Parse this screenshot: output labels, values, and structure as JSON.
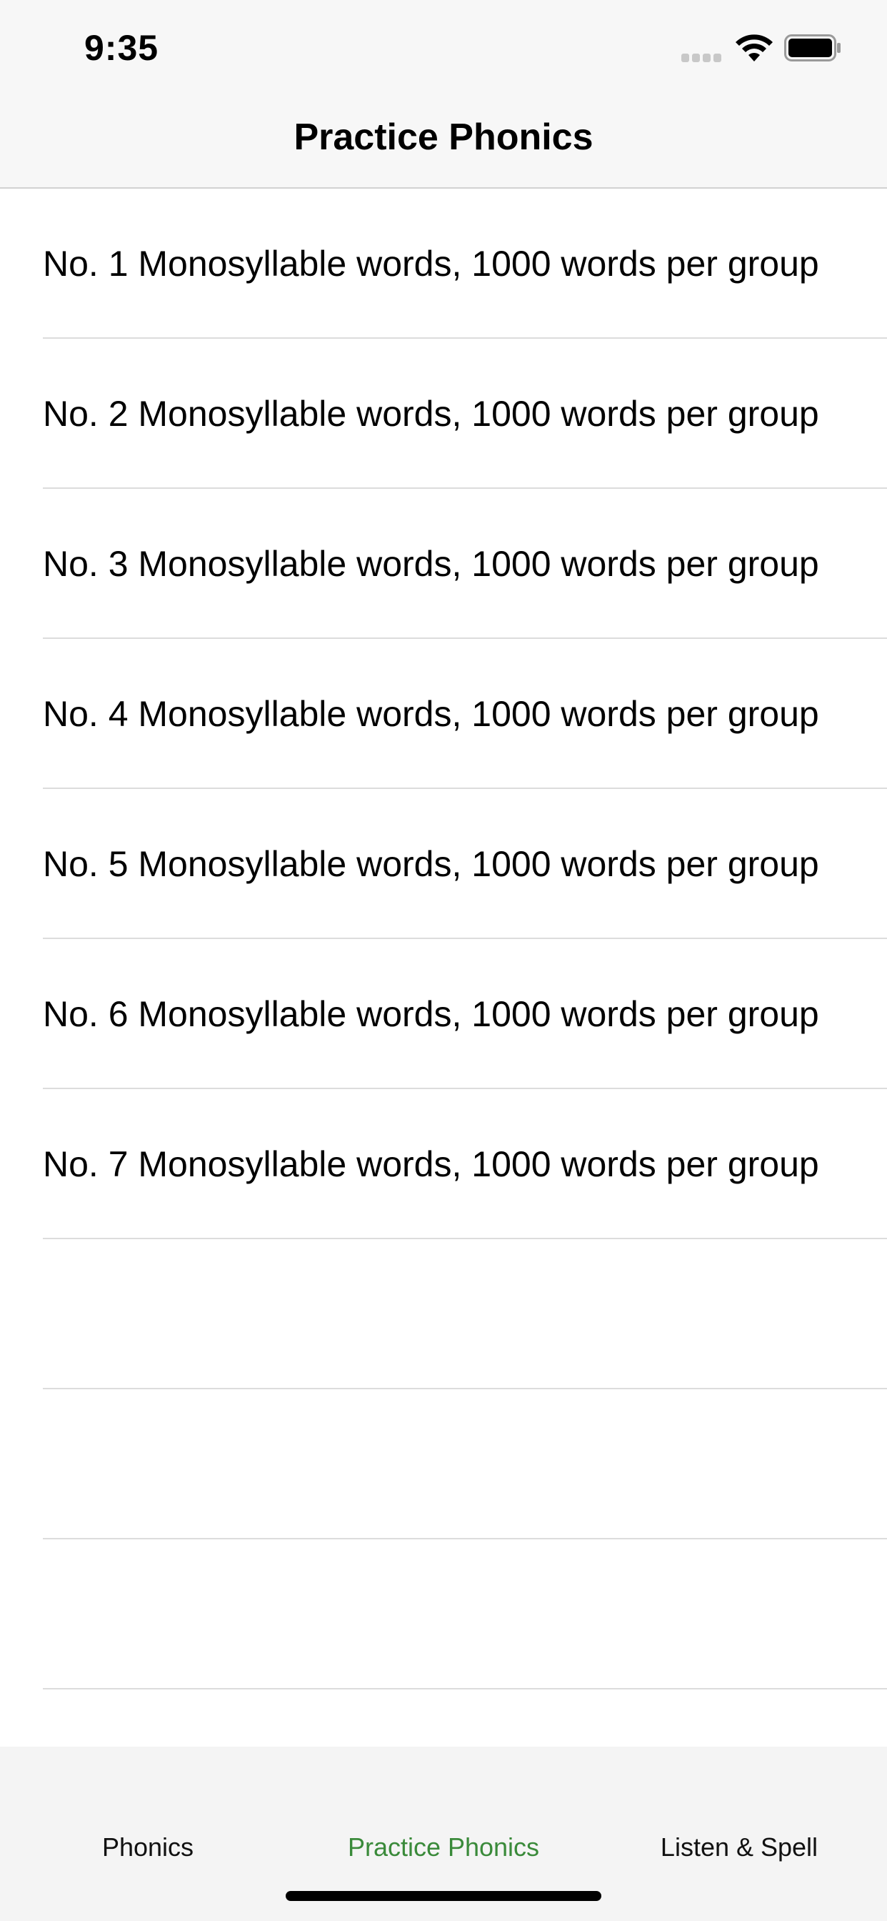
{
  "status_bar": {
    "time": "9:35"
  },
  "nav": {
    "title": "Practice Phonics"
  },
  "list": {
    "items": [
      {
        "label": "No. 1 Monosyllable words, 1000 words per group"
      },
      {
        "label": "No. 2 Monosyllable words, 1000 words per group"
      },
      {
        "label": "No. 3 Monosyllable words, 1000 words per group"
      },
      {
        "label": "No. 4 Monosyllable words, 1000 words per group"
      },
      {
        "label": "No. 5 Monosyllable words, 1000 words per group"
      },
      {
        "label": "No. 6 Monosyllable words, 1000 words per group"
      },
      {
        "label": "No. 7 Monosyllable words, 1000 words per group"
      }
    ]
  },
  "tab_bar": {
    "tabs": [
      {
        "label": "Phonics"
      },
      {
        "label": "Practice Phonics"
      },
      {
        "label": "Listen & Spell"
      }
    ],
    "active_index": 1,
    "active_color": "#3a8a3a",
    "inactive_color": "#111111"
  },
  "icons": {
    "signal": "cellular-signal-icon",
    "wifi": "wifi-icon",
    "battery": "battery-icon"
  }
}
